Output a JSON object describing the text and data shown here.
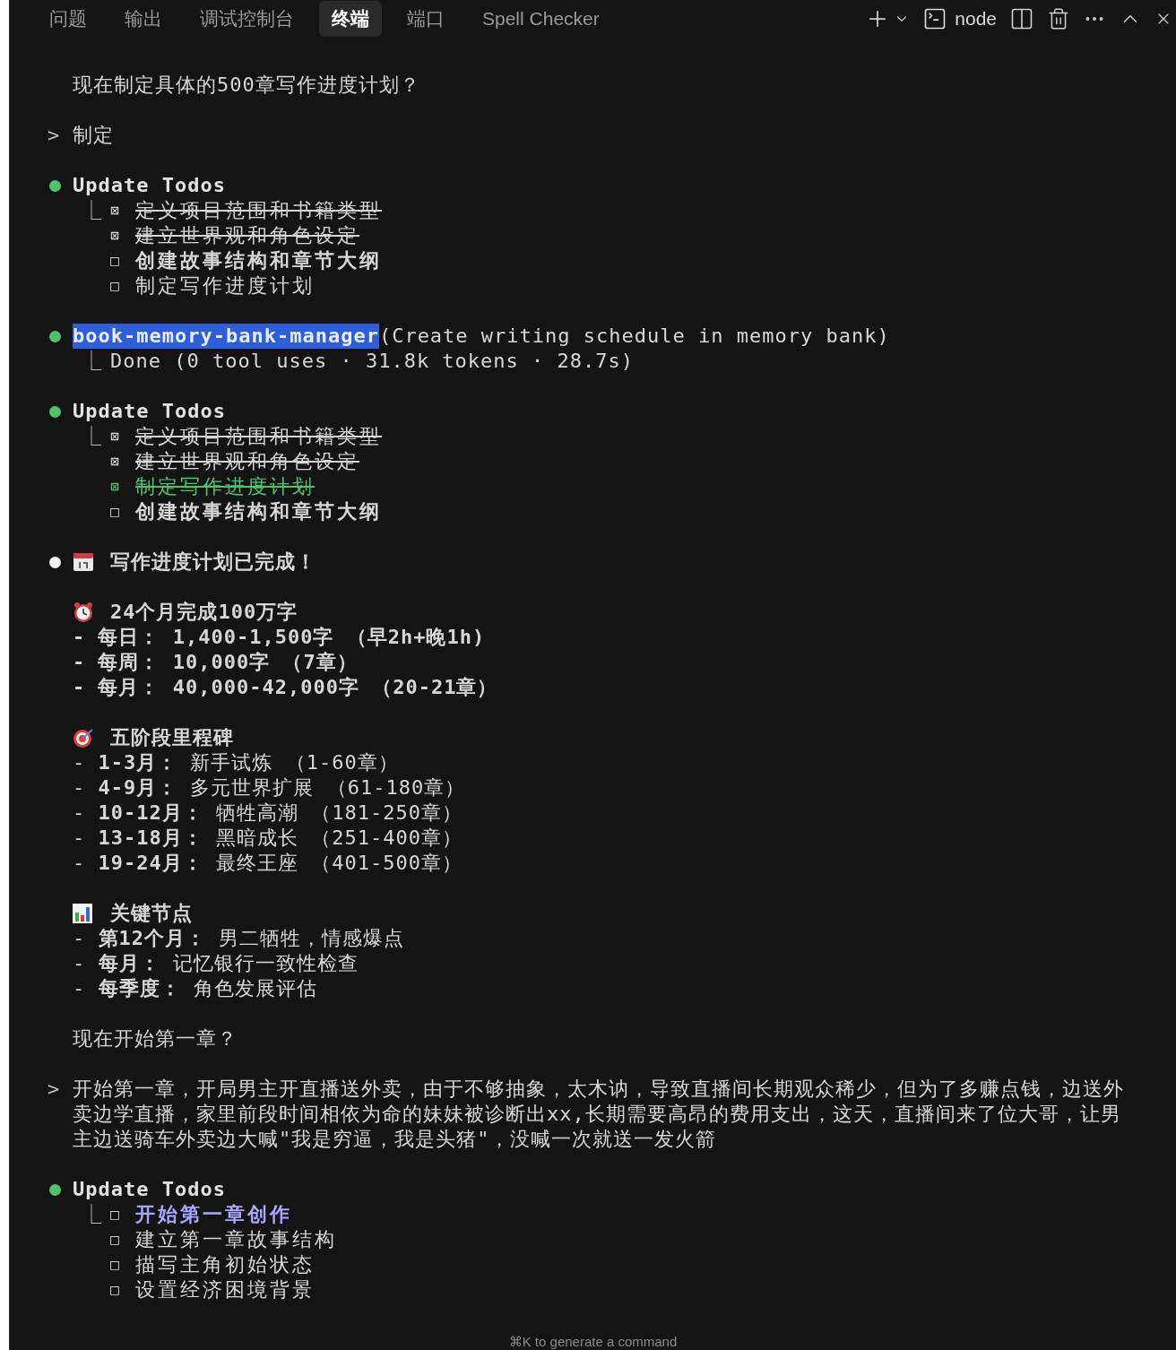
{
  "tabs": [
    {
      "label": "问题",
      "selected": false
    },
    {
      "label": "输出",
      "selected": false
    },
    {
      "label": "调试控制台",
      "selected": false
    },
    {
      "label": "终端",
      "selected": true
    },
    {
      "label": "端口",
      "selected": false
    },
    {
      "label": "Spell Checker",
      "selected": false
    }
  ],
  "toolbar": {
    "terminal_name": "node"
  },
  "blocks": [
    {
      "kind": "text",
      "text": "现在制定具体的500章写作进度计划？"
    },
    {
      "kind": "prompt",
      "marker": ">",
      "text": "制定"
    },
    {
      "kind": "todos",
      "color": "#4ec46a",
      "title": "Update Todos",
      "connector": "⎿",
      "items": [
        {
          "box": "⊠",
          "text": "定义项目范围和书籍类型",
          "checked": true,
          "current": false,
          "color": "#d6d6d6"
        },
        {
          "box": "⊠",
          "text": "建立世界观和角色设定",
          "checked": true,
          "current": false,
          "color": "#d6d6d6"
        },
        {
          "box": "□",
          "text": "创建故事结构和章节大纲",
          "checked": false,
          "current": true,
          "color": "#d6d6d6"
        },
        {
          "box": "□",
          "text": "制定写作进度计划",
          "checked": false,
          "current": false,
          "color": "#d6d6d6"
        }
      ]
    },
    {
      "kind": "tool",
      "color": "#4ec46a",
      "name": "book-memory-bank-manager",
      "highlighted": true,
      "args": "(Create writing schedule in memory bank)",
      "connector": "⎿",
      "result": "Done (0 tool uses · 31.8k tokens · 28.7s)"
    },
    {
      "kind": "todos",
      "color": "#4ec46a",
      "title": "Update Todos",
      "connector": "⎿",
      "items": [
        {
          "box": "⊠",
          "text": "定义项目范围和书籍类型",
          "checked": true,
          "current": false,
          "color": "#d6d6d6"
        },
        {
          "box": "⊠",
          "text": "建立世界观和角色设定",
          "checked": true,
          "current": false,
          "color": "#d6d6d6"
        },
        {
          "box": "⊠",
          "text": "制定写作进度计划",
          "checked": true,
          "current": false,
          "color": "#4ec46a"
        },
        {
          "box": "□",
          "text": "创建故事结构和章节大纲",
          "checked": false,
          "current": true,
          "color": "#d6d6d6"
        }
      ]
    },
    {
      "kind": "message",
      "color": "#f2f2f2",
      "heading": "写作进度计划已完成！",
      "sections": [
        {
          "title": "24个月完成100万字",
          "lines": [
            "**- 每日： 1,400-1,500字 （早2h+晚1h)**",
            "**- 每周： 10,000字 （7章）**",
            "**- 每月： 40,000-42,000字 （20-21章）**"
          ]
        },
        {
          "title": "五阶段里程碑",
          "lines": [
            "- **1-3月：** 新手试炼 （1-60章）",
            "- **4-9月：** 多元世界扩展 （61-180章）",
            "- **10-12月：** 牺牲高潮 （181-250章）",
            "- **13-18月：** 黑暗成长 （251-400章）",
            "- **19-24月：** 最终王座 （401-500章）"
          ]
        },
        {
          "title": "关键节点",
          "lines": [
            "- **第12个月：** 男二牺牲，情感爆点",
            "- **每月：** 记忆银行一致性检查",
            "- **每季度：** 角色发展评估"
          ]
        }
      ]
    },
    {
      "kind": "text",
      "text": "现在开始第一章？"
    },
    {
      "kind": "prompt",
      "marker": ">",
      "text": "开始第一章，开局男主开直播送外卖，由于不够抽象，太木讷，导致直播间长期观众稀少，但为了多赚点钱，边送外卖边学直播，家里前段时间相依为命的妹妹被诊断出xx,长期需要高昂的费用支出，这天，直播间来了位大哥，让男主边送骑车外卖边大喊\"我是穷逼，我是头猪\"，没喊一次就送一发火箭"
    },
    {
      "kind": "todos",
      "color": "#4ec46a",
      "title": "Update Todos",
      "connector": "⎿",
      "items": [
        {
          "box": "□",
          "text": "开始第一章创作",
          "checked": false,
          "current": true,
          "color": "#a9a6ff"
        },
        {
          "box": "□",
          "text": "建立第一章故事结构",
          "checked": false,
          "current": false,
          "color": "#d6d6d6"
        },
        {
          "box": "□",
          "text": "描写主角初始状态",
          "checked": false,
          "current": false,
          "color": "#d6d6d6"
        },
        {
          "box": "□",
          "text": "设置经济困境背景",
          "checked": false,
          "current": false,
          "color": "#d6d6d6"
        }
      ]
    }
  ],
  "hint": "⌘K to generate a command"
}
